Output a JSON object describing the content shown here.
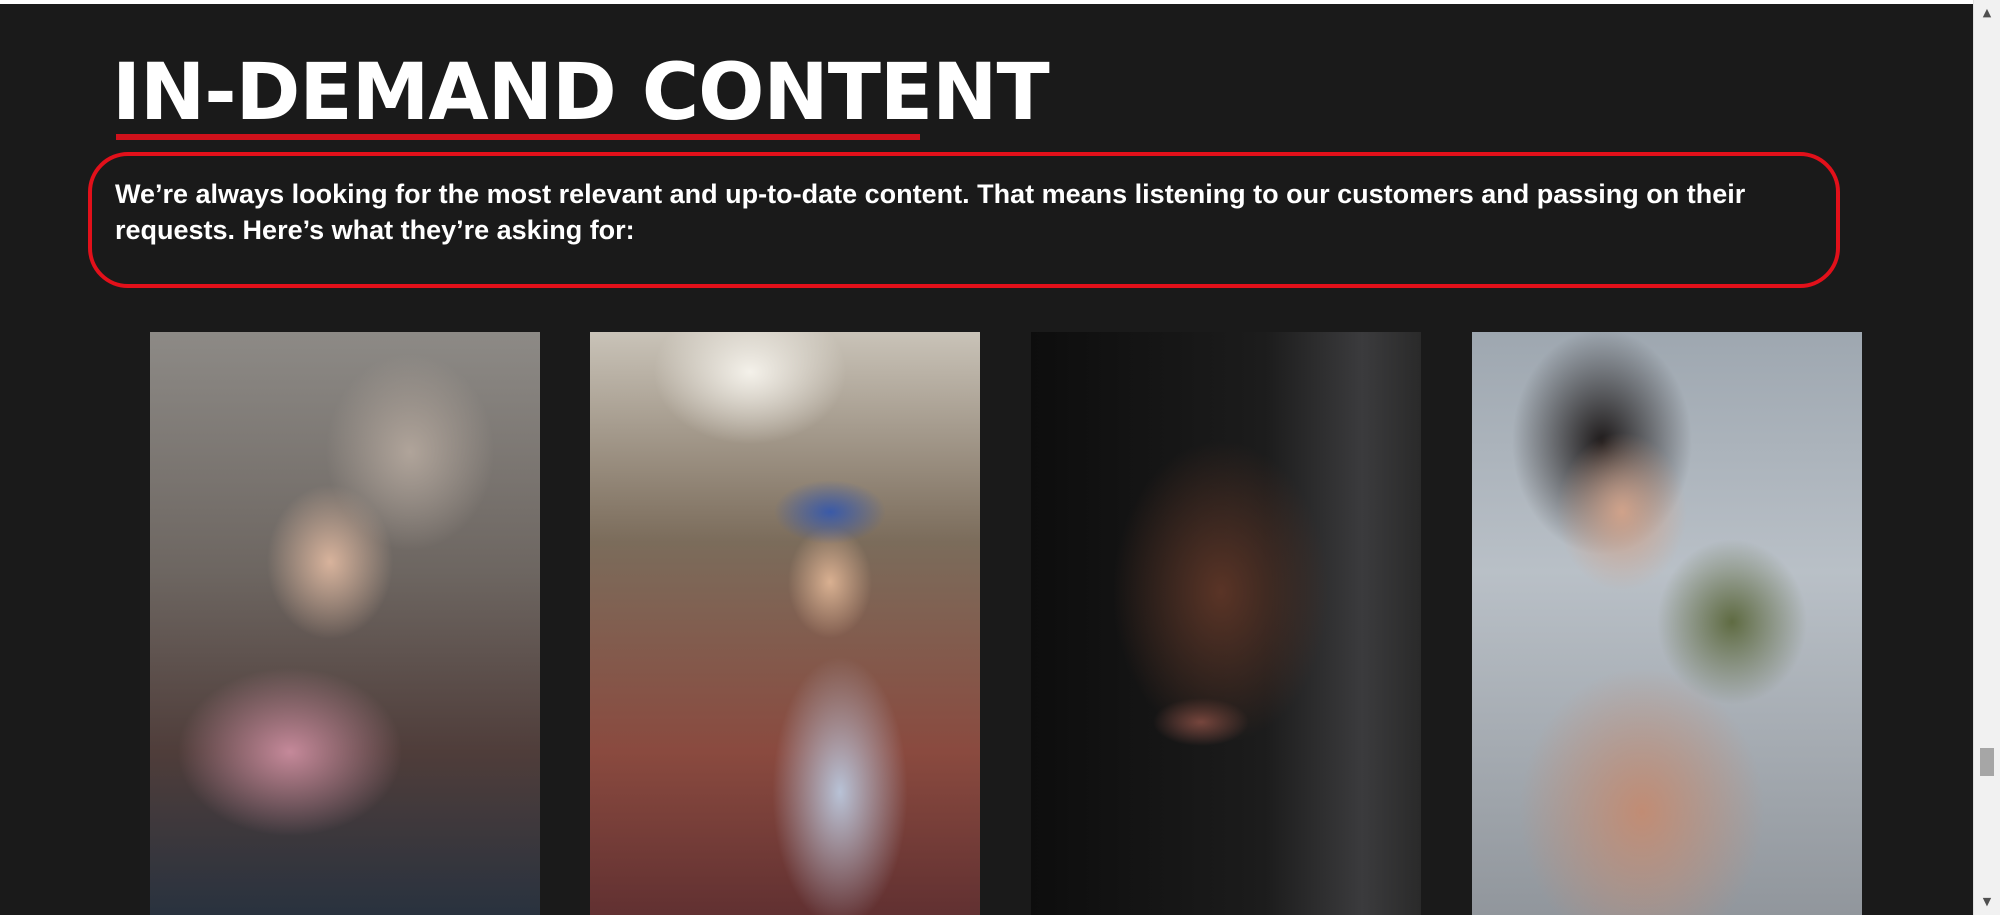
{
  "section": {
    "heading": "IN-DEMAND CONTENT",
    "intro": "We’re always looking for the most relevant and up-to-date content. That means listening to our customers and passing on their requests. Here’s what they’re asking for:",
    "accent_color": "#d0111b",
    "annotation_color": "#e2101a",
    "background_color": "#1a1a1a"
  },
  "photos": [
    {
      "subject": "two men embracing, tattooed arms"
    },
    {
      "subject": "young woman in blue hat in a market alley"
    },
    {
      "subject": "portrait of a woman in black"
    },
    {
      "subject": "child biting a toy dinosaur"
    }
  ],
  "scrollbar": {
    "up_icon": "scroll-up-arrow-icon",
    "down_icon": "scroll-down-arrow-icon",
    "position_fraction": 0.85
  }
}
